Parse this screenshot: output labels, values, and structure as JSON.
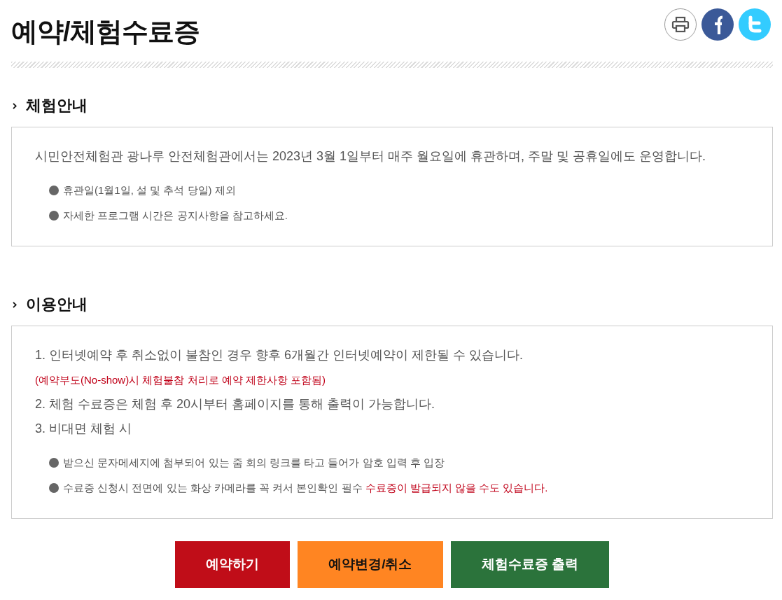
{
  "page": {
    "title": "예약/체험수료증"
  },
  "sections": [
    {
      "heading": "체험안내",
      "items": [
        {
          "kind": "lead",
          "text": "시민안전체험관 광나루 안전체험관에서는 2023년 3월 1일부터 매주 월요일에 휴관하며, 주말 및 공휴일에도 운영합니다."
        },
        {
          "kind": "bullet",
          "text": "휴관일(1월1일, 설 및 추석 당일) 제외"
        },
        {
          "kind": "bullet",
          "text": "자세한 프로그램 시간은 공지사항을 참고하세요."
        }
      ]
    },
    {
      "heading": "이용안내",
      "items": [
        {
          "kind": "lead",
          "text": "1. 인터넷예약 후 취소없이 불참인 경우 향후 6개월간 인터넷예약이 제한될 수 있습니다."
        },
        {
          "kind": "note",
          "text": "(예약부도(No-show)시 체험불참 처리로 예약 제한사항 포함됨)"
        },
        {
          "kind": "lead",
          "text": "2. 체험 수료증은 체험 후 20시부터 홈페이지를 통해 출력이 가능합니다."
        },
        {
          "kind": "lead",
          "text": "3. 비대면 체험 시"
        },
        {
          "kind": "bullet",
          "text": "받으신 문자메세지에 첨부되어 있는 줌 회의 링크를 타고 들어가 암호 입력 후 입장"
        },
        {
          "kind": "bullet",
          "text": "수료증 신청시 전면에 있는 화상 카메라를 꼭 켜서 본인확인 필수",
          "warning": "수료증이 발급되지 않을 수도 있습니다."
        }
      ]
    }
  ],
  "buttons": [
    {
      "label": "예약하기",
      "color": "#c00d18"
    },
    {
      "label": "예약변경/취소",
      "color": "#ff8522"
    },
    {
      "label": "체험수료증 출력",
      "color": "#2b733b"
    }
  ]
}
